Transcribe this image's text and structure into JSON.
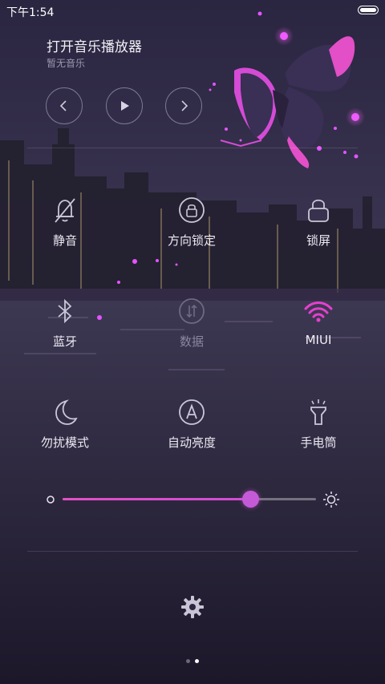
{
  "status": {
    "time": "下午1:54"
  },
  "music": {
    "title": "打开音乐播放器",
    "subtitle": "暂无音乐",
    "controls": [
      {
        "name": "previous",
        "icon": "chevron-left-icon"
      },
      {
        "name": "play",
        "icon": "play-icon"
      },
      {
        "name": "next",
        "icon": "chevron-right-icon"
      }
    ]
  },
  "toggles": [
    {
      "label": "静音",
      "icon": "bell-off-icon",
      "state": "normal"
    },
    {
      "label": "方向锁定",
      "icon": "rotation-lock-icon",
      "state": "normal"
    },
    {
      "label": "锁屏",
      "icon": "lock-icon",
      "state": "normal"
    },
    {
      "label": "蓝牙",
      "icon": "bluetooth-icon",
      "state": "normal"
    },
    {
      "label": "数据",
      "icon": "mobile-data-icon",
      "state": "dim"
    },
    {
      "label": "MIUI",
      "icon": "wifi-icon",
      "state": "active"
    },
    {
      "label": "勿扰模式",
      "icon": "moon-icon",
      "state": "normal"
    },
    {
      "label": "自动亮度",
      "icon": "auto-brightness-icon",
      "state": "normal"
    },
    {
      "label": "手电筒",
      "icon": "flashlight-icon",
      "state": "normal"
    }
  ],
  "brightness": {
    "value": 0.74
  },
  "pager": {
    "count": 2,
    "current": 2
  },
  "colors": {
    "accent": "#e24fc7",
    "active_icon": "#e63fd0",
    "background": "#1f1a33"
  }
}
